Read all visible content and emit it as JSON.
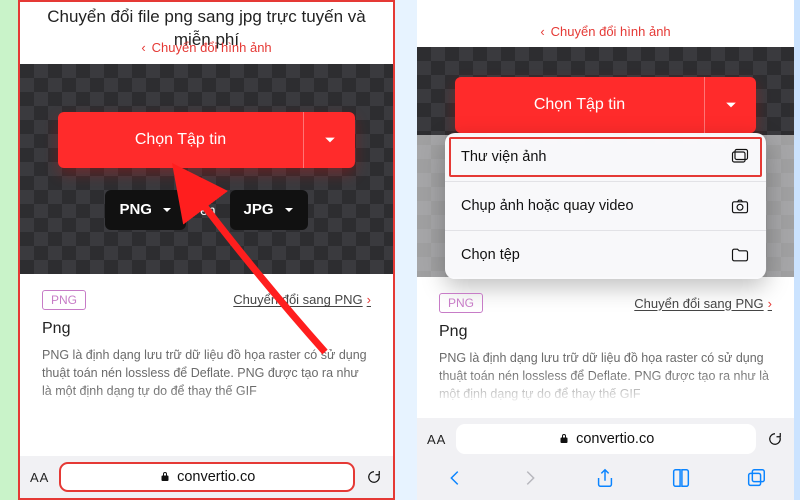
{
  "colors": {
    "accent_red": "#ff2b2b",
    "highlight_red": "#e53935",
    "ios_blue": "#0a84ff"
  },
  "left": {
    "title": "Chuyển đổi file png sang jpg trực tuyến và miễn phí",
    "nav_back": "Chuyển đổi hình ảnh",
    "choose_label": "Chọn Tập tin",
    "fmt_from": "PNG",
    "to_word": "ến",
    "fmt_to": "JPG",
    "badge": "PNG",
    "link": "Chuyển đổi sang PNG",
    "heading": "Png",
    "para": "PNG là định dạng lưu trữ dữ liệu đồ họa raster có sử dụng thuật toán nén lossless để Deflate. PNG được tạo ra như là một định dạng tự do để thay thế GIF",
    "aa": "AA",
    "url": "convertio.co"
  },
  "right": {
    "nav_back": "Chuyển đổi hình ảnh",
    "choose_label": "Chọn Tập tin",
    "menu": {
      "photo_library": "Thư viện ảnh",
      "take_photo": "Chụp ảnh hoặc quay video",
      "choose_file": "Chọn tệp"
    },
    "badge": "PNG",
    "link": "Chuyển đổi sang PNG",
    "heading": "Png",
    "para": "PNG là định dạng lưu trữ dữ liệu đồ họa raster có sử dụng thuật toán nén lossless để Deflate. PNG được tạo ra như là một định dạng tự do để thay thế GIF",
    "aa": "AA",
    "url": "convertio.co"
  }
}
